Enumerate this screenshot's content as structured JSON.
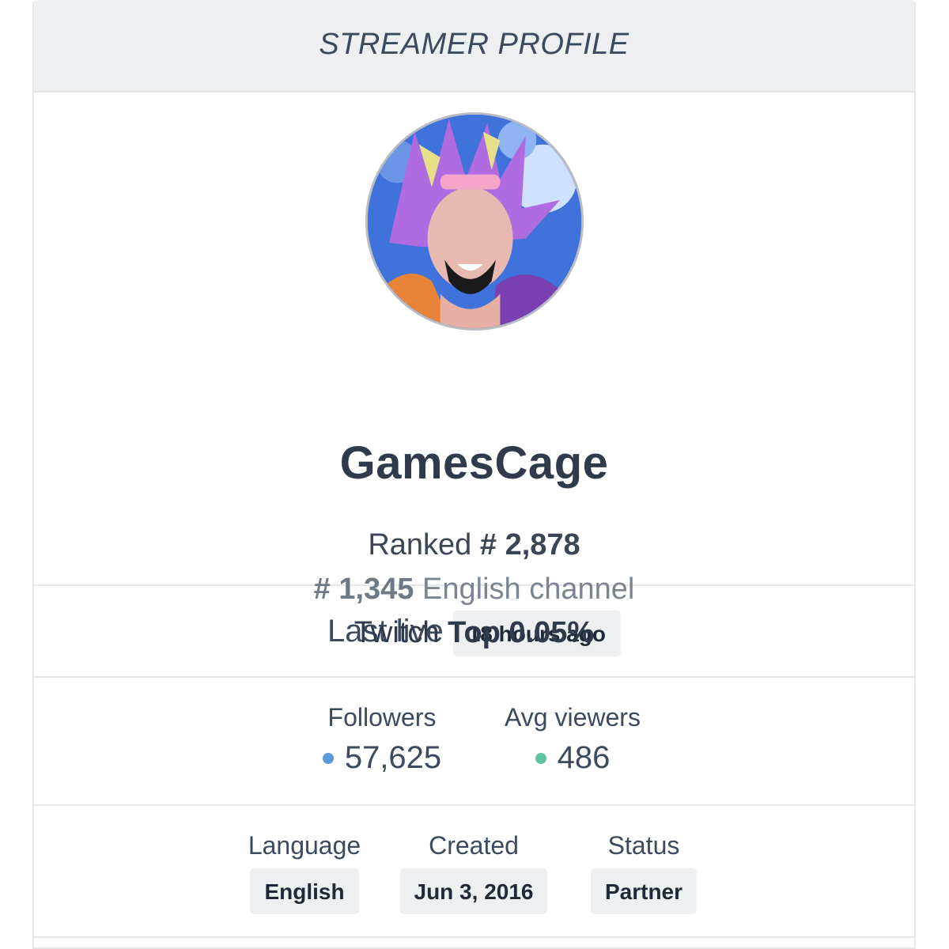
{
  "header": {
    "title": "STREAMER PROFILE"
  },
  "profile": {
    "avatar_alt": "avatar",
    "name": "GamesCage",
    "ranked_prefix": "Ranked",
    "ranked_value": "# 2,878",
    "language_rank_value": "# 1,345",
    "language_rank_suffix": "English channel",
    "top_prefix": "Twitch",
    "top_value": "Top 0.05%"
  },
  "last_live": {
    "label": "Last live",
    "value": "18 hours ago"
  },
  "stats": {
    "followers": {
      "label": "Followers",
      "value": "57,625",
      "dot_color": "#5b9ad8"
    },
    "avg_viewers": {
      "label": "Avg viewers",
      "value": "486",
      "dot_color": "#5fc2a3"
    }
  },
  "meta": {
    "language": {
      "label": "Language",
      "value": "English"
    },
    "created": {
      "label": "Created",
      "value": "Jun 3, 2016"
    },
    "status": {
      "label": "Status",
      "value": "Partner"
    }
  },
  "colors": {
    "header_bg": "#edeff1",
    "badge_bg": "#edeff1",
    "text": "#2f3a4c"
  }
}
